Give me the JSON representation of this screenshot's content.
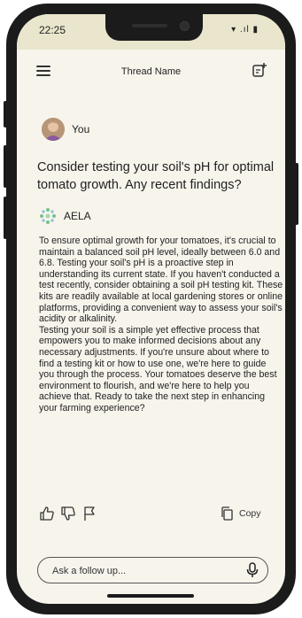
{
  "status_bar": {
    "time": "22:25",
    "icons_text": "▾ .ıl ▮"
  },
  "header": {
    "title": "Thread Name"
  },
  "user": {
    "name": "You"
  },
  "question": "Consider testing your soil's pH for optimal tomato growth. Any recent findings?",
  "assistant": {
    "name": "AELA",
    "paragraph_1": "To ensure optimal growth for your tomatoes, it's crucial to maintain a balanced soil pH level, ideally between 6.0 and 6.8. Testing your soil's pH is a proactive step in understanding its current state. If you haven't conducted a test recently, consider obtaining a soil pH testing kit. These kits are readily available at local gardening stores or online platforms, providing a convenient way to assess your soil's acidity or alkalinity.",
    "paragraph_2": "Testing your soil is a simple yet effective process that empowers you to make informed decisions about any necessary adjustments. If you're unsure about where to find a testing kit or how to use one, we're here to guide you through the process. Your tomatoes deserve the best environment to flourish, and we're here to help you achieve that. Ready to take the next step in enhancing your farming experience?"
  },
  "actions": {
    "copy_label": "Copy"
  },
  "followup": {
    "placeholder": "Ask a follow up..."
  },
  "icons": {
    "menu": "menu-icon",
    "new_chat": "new-chat-icon",
    "like": "thumbs-up-icon",
    "dislike": "thumbs-down-icon",
    "flag": "flag-icon",
    "copy": "copy-icon",
    "mic": "microphone-icon"
  },
  "colors": {
    "status_bar_bg": "#e9e6cd",
    "screen_bg": "#f7f4ec",
    "aela_green": "#7bbf8e",
    "aela_blue": "#8cc6dd"
  }
}
